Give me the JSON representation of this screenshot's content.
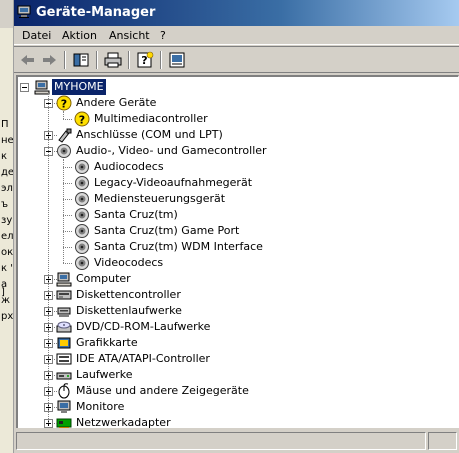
{
  "window": {
    "title": "Geräte-Manager"
  },
  "background_window": {
    "fragments": [
      "П",
      "не",
      "к",
      "де",
      "эль",
      "ъ",
      "зу",
      "ел",
      "ок",
      "к \"",
      "а",
      "ж",
      "рх",
      "]"
    ]
  },
  "menu": [
    "Datei",
    "Aktion",
    "Ansicht",
    "?"
  ],
  "toolbar": {
    "buttons": [
      "back-icon",
      "forward-icon",
      "console-tree-icon",
      "print-icon",
      "help-icon",
      "properties-icon"
    ]
  },
  "tree": {
    "root": "MYHOME",
    "categories": [
      {
        "label": "Andere Geräte",
        "icon": "unknown-device-icon",
        "expanded": true,
        "children": [
          "Multimediacontroller"
        ]
      },
      {
        "label": "Anschlüsse (COM und LPT)",
        "icon": "port-icon",
        "expanded": false
      },
      {
        "label": "Audio-, Video- und Gamecontroller",
        "icon": "speaker-icon",
        "expanded": true,
        "children": [
          "Audiocodecs",
          "Legacy-Videoaufnahmegerät",
          "Mediensteuerungsgerät",
          "Santa Cruz(tm)",
          "Santa Cruz(tm) Game Port",
          "Santa Cruz(tm) WDM Interface",
          "Videocodecs"
        ]
      },
      {
        "label": "Computer",
        "icon": "computer-icon",
        "expanded": false
      },
      {
        "label": "Diskettencontroller",
        "icon": "controller-icon",
        "expanded": false
      },
      {
        "label": "Diskettenlaufwerke",
        "icon": "floppy-icon",
        "expanded": false
      },
      {
        "label": "DVD/CD-ROM-Laufwerke",
        "icon": "cdrom-icon",
        "expanded": false
      },
      {
        "label": "Grafikkarte",
        "icon": "display-adapter-icon",
        "expanded": false
      },
      {
        "label": "IDE ATA/ATAPI-Controller",
        "icon": "ide-controller-icon",
        "expanded": false
      },
      {
        "label": "Laufwerke",
        "icon": "harddisk-icon",
        "expanded": false
      },
      {
        "label": "Mäuse und andere Zeigegeräte",
        "icon": "mouse-icon",
        "expanded": false
      },
      {
        "label": "Monitore",
        "icon": "monitor-icon",
        "expanded": false
      },
      {
        "label": "Netzwerkadapter",
        "icon": "network-adapter-icon",
        "expanded": false
      }
    ]
  },
  "colors": {
    "selection": "#0a246a",
    "titlebar_start": "#0a246a",
    "titlebar_end": "#a6caf0",
    "face": "#d4d0c8"
  }
}
